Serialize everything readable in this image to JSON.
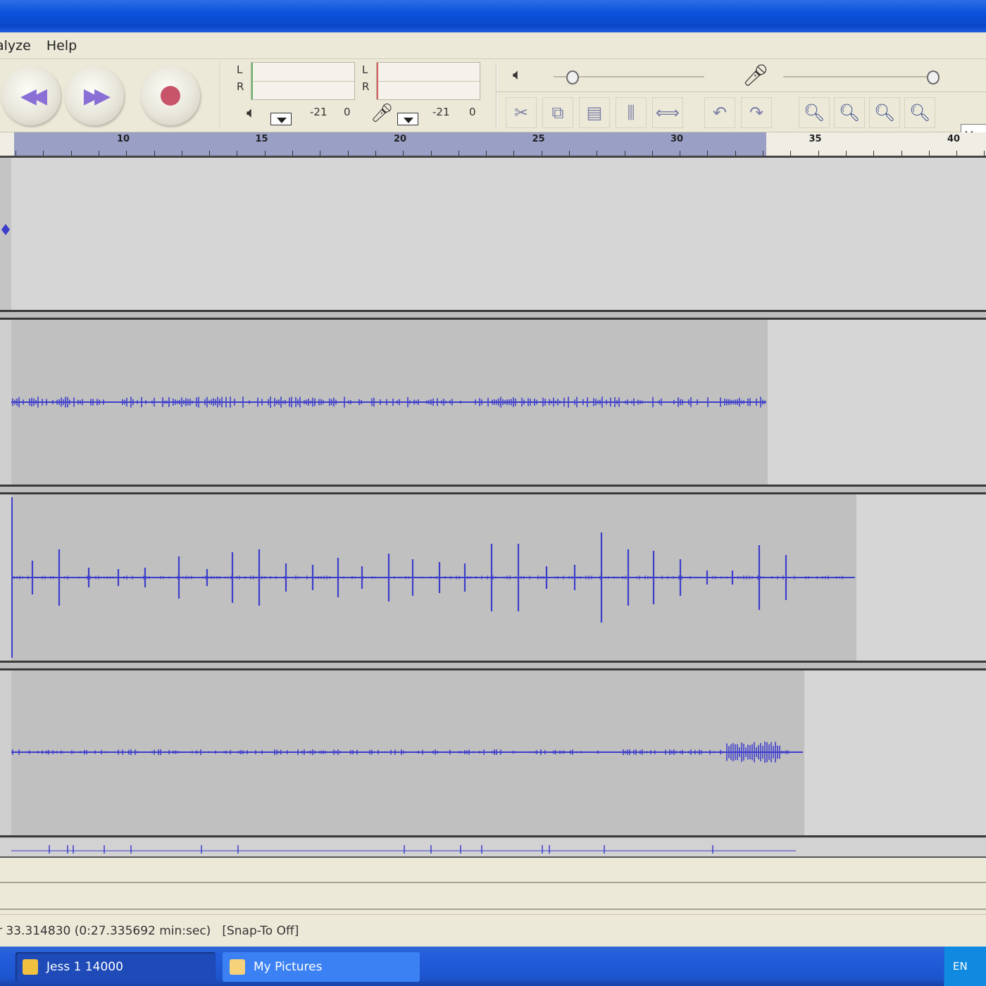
{
  "menu": {
    "items": [
      "alyze",
      "Help"
    ]
  },
  "toolbar": {
    "meter_play": {
      "l": "L",
      "r": "R",
      "scale_a": "-21",
      "scale_b": "0"
    },
    "meter_rec": {
      "l": "L",
      "r": "R",
      "scale_a": "-21",
      "scale_b": "0"
    },
    "field_value": "Mo"
  },
  "ruler": {
    "ticks": [
      "10",
      "15",
      "20",
      "25",
      "30",
      "35",
      "40"
    ]
  },
  "status": {
    "position": "r 33.314830 (0:27.335692 min:sec)",
    "snap": "[Snap-To Off]"
  },
  "taskbar": {
    "task1": "Jess 1 14000",
    "task2": "My Pictures",
    "tray": "EN"
  },
  "colors": {
    "waveform": "#3d3dcc",
    "selection": "#9a9fc5",
    "taskbar": "#245edc"
  }
}
